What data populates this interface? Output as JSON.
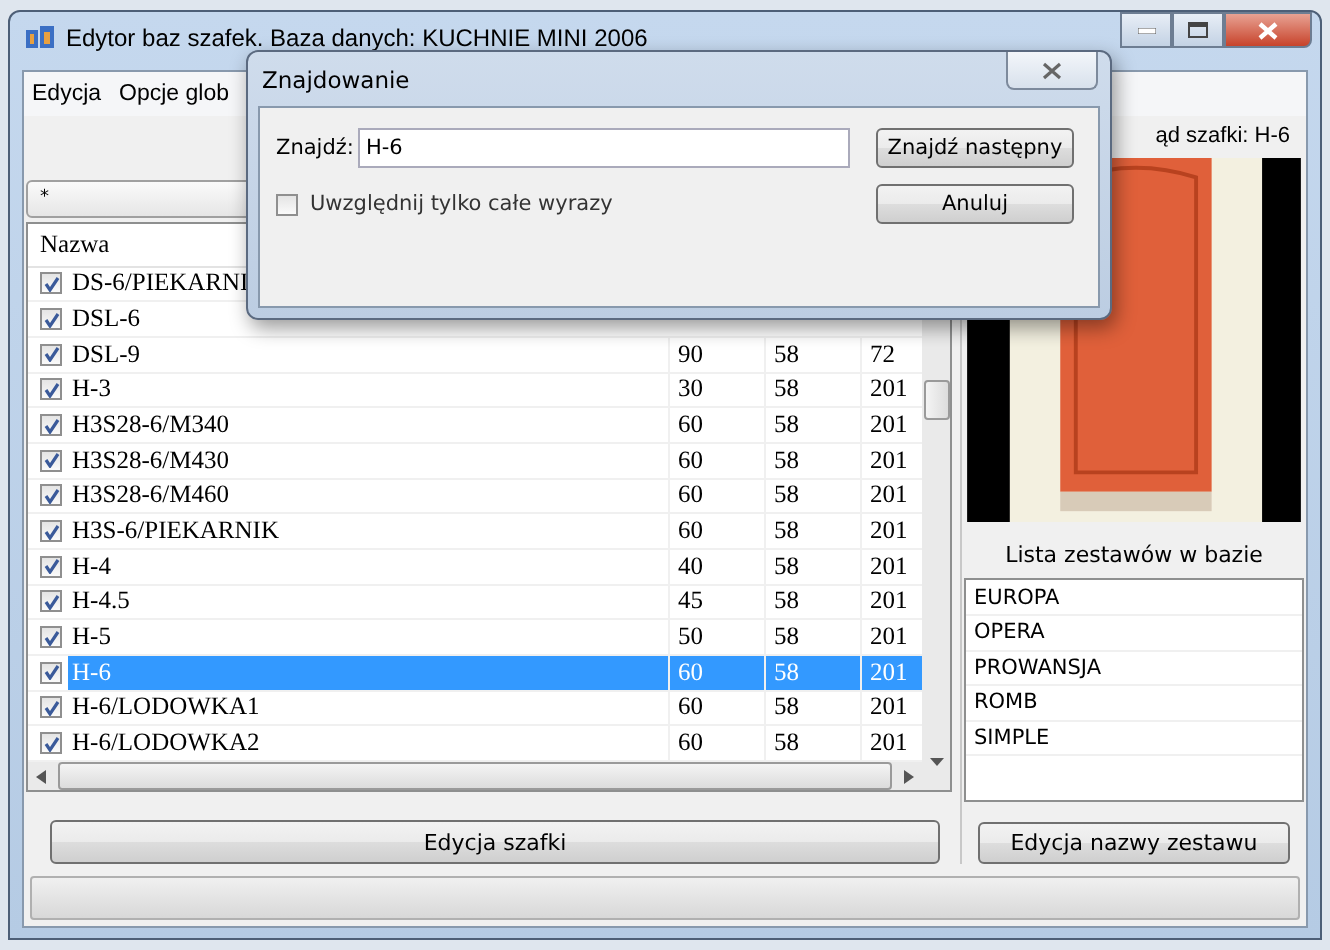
{
  "window": {
    "title": "Edytor baz szafek. Baza danych: KUCHNIE MINI 2006"
  },
  "menu": [
    "Edycja",
    "Opcje glob"
  ],
  "filter": {
    "value": "*"
  },
  "table": {
    "columns": [
      "Nazwa"
    ],
    "rows": [
      {
        "name": "DS-6/PIEKARNI",
        "checked": true,
        "selected": false
      },
      {
        "name": "DSL-6",
        "checked": true,
        "selected": false
      },
      {
        "name": "DSL-9",
        "values": [
          "90",
          "58",
          "72"
        ],
        "checked": true,
        "selected": false
      },
      {
        "name": "H-3",
        "values": [
          "30",
          "58",
          "201"
        ],
        "checked": true,
        "selected": false
      },
      {
        "name": "H3S28-6/M340",
        "values": [
          "60",
          "58",
          "201"
        ],
        "checked": true,
        "selected": false
      },
      {
        "name": "H3S28-6/M430",
        "values": [
          "60",
          "58",
          "201"
        ],
        "checked": true,
        "selected": false
      },
      {
        "name": "H3S28-6/M460",
        "values": [
          "60",
          "58",
          "201"
        ],
        "checked": true,
        "selected": false
      },
      {
        "name": "H3S-6/PIEKARNIK",
        "values": [
          "60",
          "58",
          "201"
        ],
        "checked": true,
        "selected": false
      },
      {
        "name": "H-4",
        "values": [
          "40",
          "58",
          "201"
        ],
        "checked": true,
        "selected": false
      },
      {
        "name": "H-4.5",
        "values": [
          "45",
          "58",
          "201"
        ],
        "checked": true,
        "selected": false
      },
      {
        "name": "H-5",
        "values": [
          "50",
          "58",
          "201"
        ],
        "checked": true,
        "selected": false
      },
      {
        "name": "H-6",
        "values": [
          "60",
          "58",
          "201"
        ],
        "checked": true,
        "selected": true
      },
      {
        "name": "H-6/LODOWKA1",
        "values": [
          "60",
          "58",
          "201"
        ],
        "checked": true,
        "selected": false
      },
      {
        "name": "H-6/LODOWKA2",
        "values": [
          "60",
          "58",
          "201"
        ],
        "checked": true,
        "selected": false
      }
    ]
  },
  "edit_button": "Edycja szafki",
  "preview": {
    "label": "ąd szafki: H-6"
  },
  "sets": {
    "caption": "Lista zestawów w bazie",
    "items": [
      {
        "label": "EUROPA",
        "selected": false
      },
      {
        "label": "OPERA",
        "selected": false
      },
      {
        "label": "PROWANSJA",
        "selected": false
      },
      {
        "label": "ROMB",
        "selected": false
      },
      {
        "label": "SIMPLE",
        "selected": false
      }
    ],
    "button": "Edycja nazwy zestawu"
  },
  "dialog": {
    "title": "Znajdowanie",
    "find_label": "Znajdź:",
    "find_value": "H-6",
    "whole_words": {
      "label": "Uwzględnij tylko całe wyrazy",
      "checked": false
    },
    "buttons": [
      "Znajdź następny",
      "Anuluj"
    ]
  }
}
